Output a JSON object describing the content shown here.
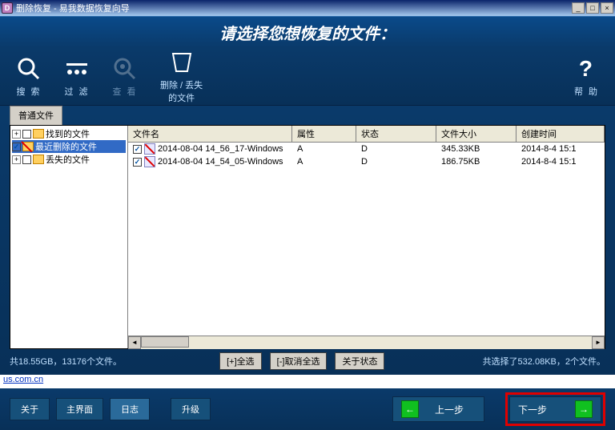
{
  "title": "删除恢复 - 易我数据恢复向导",
  "header_prompt": "请选择您想恢复的文件：",
  "toolbar": {
    "search": "搜 索",
    "filter": "过 滤",
    "view": "查 看",
    "deleted": "删除 / 丢失\n的文件",
    "help": "帮 助"
  },
  "tab_label": "普通文件",
  "tree": [
    {
      "label": "找到的文件",
      "checked": false,
      "highlight": false
    },
    {
      "label": "最近删除的文件",
      "checked": true,
      "highlight": true,
      "selected": true
    },
    {
      "label": "丢失的文件",
      "checked": false,
      "highlight": false
    }
  ],
  "columns": {
    "name": "文件名",
    "attr": "属性",
    "stat": "状态",
    "size": "文件大小",
    "time": "创建时间"
  },
  "rows": [
    {
      "name": "2014-08-04 14_56_17-Windows",
      "attr": "A",
      "stat": "D",
      "size": "345.33KB",
      "time": "2014-8-4 15:1"
    },
    {
      "name": "2014-08-04 14_54_05-Windows",
      "attr": "A",
      "stat": "D",
      "size": "186.75KB",
      "time": "2014-8-4 15:1"
    }
  ],
  "status_left": "共18.55GB，13176个文件。",
  "btn_select_all": "[+]全选",
  "btn_deselect_all": "[-]取消全选",
  "btn_about_status": "关于状态",
  "status_right": "共选择了532.08KB，2个文件。",
  "link": "us.com.cn",
  "footer": {
    "about": "关于",
    "main": "主界面",
    "log": "日志",
    "upgrade": "升级",
    "prev": "上一步",
    "next": "下一步"
  }
}
